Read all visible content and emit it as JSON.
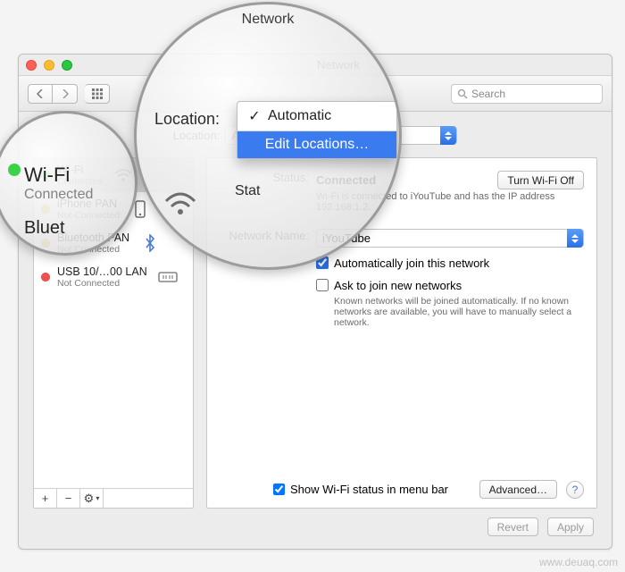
{
  "window": {
    "title": "Network"
  },
  "toolbar": {
    "back_icon": "chevron-left",
    "fwd_icon": "chevron-right",
    "grid_icon": "grid",
    "search_placeholder": "Search"
  },
  "location": {
    "label": "Location:",
    "selected": "Automatic",
    "menu": {
      "option1": "Automatic",
      "option2": "Edit Locations…"
    }
  },
  "sidebar": {
    "items": [
      {
        "name": "Wi-Fi",
        "sub": "Connected",
        "dot": "green",
        "selected": true
      },
      {
        "name": "iPhone PAN",
        "sub": "Not Connected",
        "dot": "yellow",
        "selected": false
      },
      {
        "name": "Bluetooth PAN",
        "sub": "Not Connected",
        "dot": "yellow",
        "selected": false
      },
      {
        "name": "USB 10/…00 LAN",
        "sub": "Not Connected",
        "dot": "red",
        "selected": false
      }
    ],
    "add": "+",
    "remove": "−",
    "gear": "⚙︎"
  },
  "detail": {
    "status_label": "Status:",
    "status_value": "Connected",
    "turn_off": "Turn Wi-Fi Off",
    "status_desc": "Wi-Fi is connected to iYouTube and has the IP address 192.168.1.2.",
    "network_label": "Network Name:",
    "network_value": "iYouTube",
    "auto_join": "Automatically join this network",
    "ask_join": "Ask to join new networks",
    "ask_note": "Known networks will be joined automatically. If no known networks are available, you will have to manually select a network.",
    "show_status": "Show Wi-Fi status in menu bar",
    "advanced": "Advanced…",
    "help": "?"
  },
  "footer": {
    "revert": "Revert",
    "apply": "Apply"
  },
  "zoom": {
    "wifi_title": "Wi-Fi",
    "wifi_sub": "Connected",
    "bt_label": "Bluet",
    "pan_label": "PAN",
    "pan_sub": "ected"
  },
  "watermark": "www.deuaq.com"
}
